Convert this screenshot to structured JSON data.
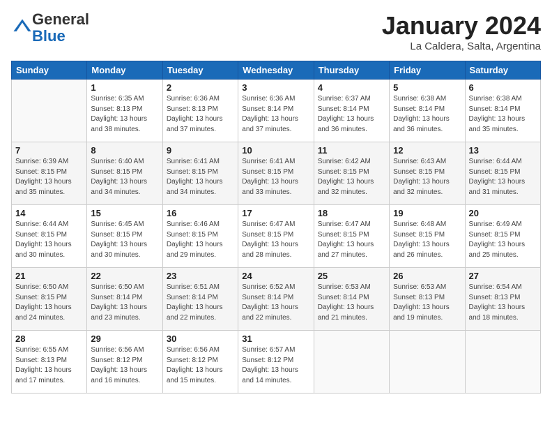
{
  "header": {
    "logo_general": "General",
    "logo_blue": "Blue",
    "title": "January 2024",
    "subtitle": "La Caldera, Salta, Argentina"
  },
  "columns": [
    "Sunday",
    "Monday",
    "Tuesday",
    "Wednesday",
    "Thursday",
    "Friday",
    "Saturday"
  ],
  "weeks": [
    [
      {
        "num": "",
        "info": ""
      },
      {
        "num": "1",
        "info": "Sunrise: 6:35 AM\nSunset: 8:13 PM\nDaylight: 13 hours\nand 38 minutes."
      },
      {
        "num": "2",
        "info": "Sunrise: 6:36 AM\nSunset: 8:13 PM\nDaylight: 13 hours\nand 37 minutes."
      },
      {
        "num": "3",
        "info": "Sunrise: 6:36 AM\nSunset: 8:14 PM\nDaylight: 13 hours\nand 37 minutes."
      },
      {
        "num": "4",
        "info": "Sunrise: 6:37 AM\nSunset: 8:14 PM\nDaylight: 13 hours\nand 36 minutes."
      },
      {
        "num": "5",
        "info": "Sunrise: 6:38 AM\nSunset: 8:14 PM\nDaylight: 13 hours\nand 36 minutes."
      },
      {
        "num": "6",
        "info": "Sunrise: 6:38 AM\nSunset: 8:14 PM\nDaylight: 13 hours\nand 35 minutes."
      }
    ],
    [
      {
        "num": "7",
        "info": "Sunrise: 6:39 AM\nSunset: 8:15 PM\nDaylight: 13 hours\nand 35 minutes."
      },
      {
        "num": "8",
        "info": "Sunrise: 6:40 AM\nSunset: 8:15 PM\nDaylight: 13 hours\nand 34 minutes."
      },
      {
        "num": "9",
        "info": "Sunrise: 6:41 AM\nSunset: 8:15 PM\nDaylight: 13 hours\nand 34 minutes."
      },
      {
        "num": "10",
        "info": "Sunrise: 6:41 AM\nSunset: 8:15 PM\nDaylight: 13 hours\nand 33 minutes."
      },
      {
        "num": "11",
        "info": "Sunrise: 6:42 AM\nSunset: 8:15 PM\nDaylight: 13 hours\nand 32 minutes."
      },
      {
        "num": "12",
        "info": "Sunrise: 6:43 AM\nSunset: 8:15 PM\nDaylight: 13 hours\nand 32 minutes."
      },
      {
        "num": "13",
        "info": "Sunrise: 6:44 AM\nSunset: 8:15 PM\nDaylight: 13 hours\nand 31 minutes."
      }
    ],
    [
      {
        "num": "14",
        "info": "Sunrise: 6:44 AM\nSunset: 8:15 PM\nDaylight: 13 hours\nand 30 minutes."
      },
      {
        "num": "15",
        "info": "Sunrise: 6:45 AM\nSunset: 8:15 PM\nDaylight: 13 hours\nand 30 minutes."
      },
      {
        "num": "16",
        "info": "Sunrise: 6:46 AM\nSunset: 8:15 PM\nDaylight: 13 hours\nand 29 minutes."
      },
      {
        "num": "17",
        "info": "Sunrise: 6:47 AM\nSunset: 8:15 PM\nDaylight: 13 hours\nand 28 minutes."
      },
      {
        "num": "18",
        "info": "Sunrise: 6:47 AM\nSunset: 8:15 PM\nDaylight: 13 hours\nand 27 minutes."
      },
      {
        "num": "19",
        "info": "Sunrise: 6:48 AM\nSunset: 8:15 PM\nDaylight: 13 hours\nand 26 minutes."
      },
      {
        "num": "20",
        "info": "Sunrise: 6:49 AM\nSunset: 8:15 PM\nDaylight: 13 hours\nand 25 minutes."
      }
    ],
    [
      {
        "num": "21",
        "info": "Sunrise: 6:50 AM\nSunset: 8:15 PM\nDaylight: 13 hours\nand 24 minutes."
      },
      {
        "num": "22",
        "info": "Sunrise: 6:50 AM\nSunset: 8:14 PM\nDaylight: 13 hours\nand 23 minutes."
      },
      {
        "num": "23",
        "info": "Sunrise: 6:51 AM\nSunset: 8:14 PM\nDaylight: 13 hours\nand 22 minutes."
      },
      {
        "num": "24",
        "info": "Sunrise: 6:52 AM\nSunset: 8:14 PM\nDaylight: 13 hours\nand 22 minutes."
      },
      {
        "num": "25",
        "info": "Sunrise: 6:53 AM\nSunset: 8:14 PM\nDaylight: 13 hours\nand 21 minutes."
      },
      {
        "num": "26",
        "info": "Sunrise: 6:53 AM\nSunset: 8:13 PM\nDaylight: 13 hours\nand 19 minutes."
      },
      {
        "num": "27",
        "info": "Sunrise: 6:54 AM\nSunset: 8:13 PM\nDaylight: 13 hours\nand 18 minutes."
      }
    ],
    [
      {
        "num": "28",
        "info": "Sunrise: 6:55 AM\nSunset: 8:13 PM\nDaylight: 13 hours\nand 17 minutes."
      },
      {
        "num": "29",
        "info": "Sunrise: 6:56 AM\nSunset: 8:12 PM\nDaylight: 13 hours\nand 16 minutes."
      },
      {
        "num": "30",
        "info": "Sunrise: 6:56 AM\nSunset: 8:12 PM\nDaylight: 13 hours\nand 15 minutes."
      },
      {
        "num": "31",
        "info": "Sunrise: 6:57 AM\nSunset: 8:12 PM\nDaylight: 13 hours\nand 14 minutes."
      },
      {
        "num": "",
        "info": ""
      },
      {
        "num": "",
        "info": ""
      },
      {
        "num": "",
        "info": ""
      }
    ]
  ]
}
